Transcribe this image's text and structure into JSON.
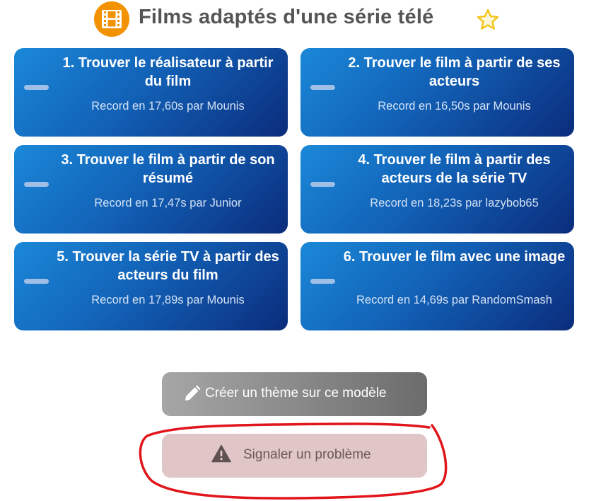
{
  "header": {
    "title": "Films adaptés d'une série télé",
    "left_icon": "film-icon",
    "right_icon": "star-outline-icon"
  },
  "themes": [
    {
      "title": "1. Trouver le réalisateur à partir du film",
      "record": "Record en 17,60s par Mounis"
    },
    {
      "title": "2. Trouver le film à partir de ses acteurs",
      "record": "Record en 16,50s par Mounis"
    },
    {
      "title": "3. Trouver le film à partir de son résumé",
      "record": "Record en 17,47s par Junior"
    },
    {
      "title": "4. Trouver le film à partir des acteurs de la série TV",
      "record": "Record en 18,23s par lazybob65"
    },
    {
      "title": "5. Trouver la série TV à partir des acteurs du film",
      "record": "Record en 17,89s par Mounis"
    },
    {
      "title": "6. Trouver le film avec une image",
      "record": "Record en 14,69s par RandomSmash"
    }
  ],
  "actions": {
    "create_label": "Créer un thème sur ce modèle",
    "create_icon": "pencil-icon",
    "report_label": "Signaler un problème",
    "report_icon": "warning-icon"
  },
  "colors": {
    "card_gradient_start": "#1b88d8",
    "card_gradient_end": "#0b2c7c",
    "title_text": "#555555",
    "film_icon_orange": "#f39200",
    "star_yellow": "#f2c418",
    "report_button_bg": "#e0c6c6",
    "annotation_red": "#e0161c"
  }
}
